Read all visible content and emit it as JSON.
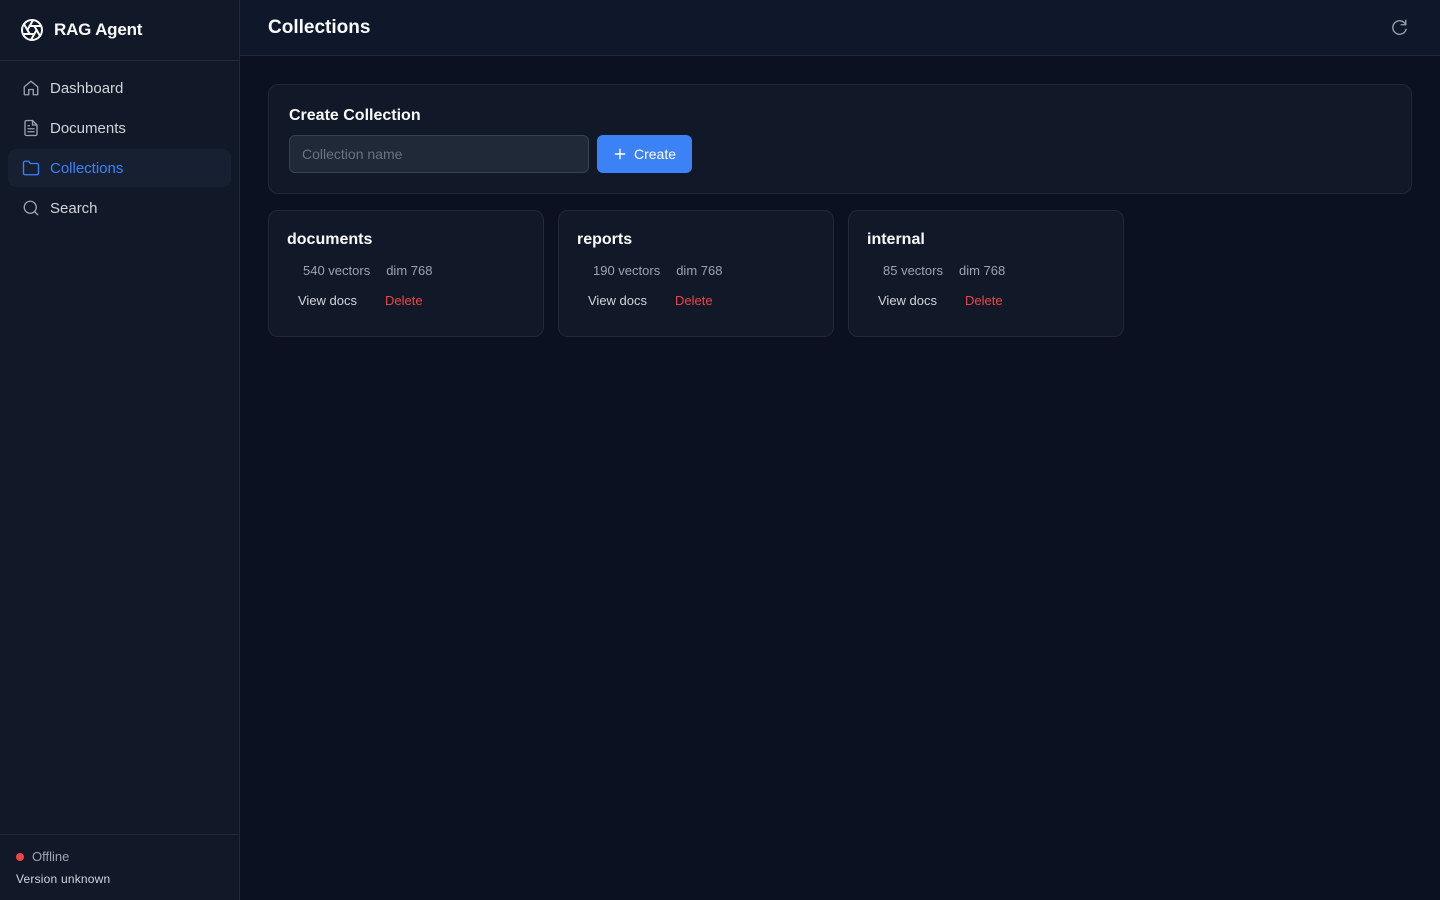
{
  "app": {
    "title": "RAG Agent",
    "brand_icon": "aperture-logo-icon"
  },
  "sidebar": {
    "items": [
      {
        "label": "Dashboard",
        "icon": "home-icon",
        "active": false
      },
      {
        "label": "Documents",
        "icon": "file-text-icon",
        "active": false
      },
      {
        "label": "Collections",
        "icon": "folder-icon",
        "active": true
      },
      {
        "label": "Search",
        "icon": "search-icon",
        "active": false
      }
    ],
    "footer": {
      "status": "Offline",
      "status_color": "#ef4444",
      "version": "Version unknown"
    }
  },
  "header": {
    "title": "Collections",
    "refresh_icon": "refresh-icon"
  },
  "create": {
    "title": "Create Collection",
    "input_placeholder": "Collection name",
    "input_value": "",
    "button_label": "Create"
  },
  "collections": [
    {
      "name": "documents",
      "vectors": "540 vectors",
      "dim": "dim 768",
      "view_label": "View docs",
      "delete_label": "Delete"
    },
    {
      "name": "reports",
      "vectors": "190 vectors",
      "dim": "dim 768",
      "view_label": "View docs",
      "delete_label": "Delete"
    },
    {
      "name": "internal",
      "vectors": "85 vectors",
      "dim": "dim 768",
      "view_label": "View docs",
      "delete_label": "Delete"
    }
  ],
  "colors": {
    "accent": "#3b82f6",
    "danger": "#ef4444",
    "background": "#0b1120",
    "panel": "#111827"
  }
}
